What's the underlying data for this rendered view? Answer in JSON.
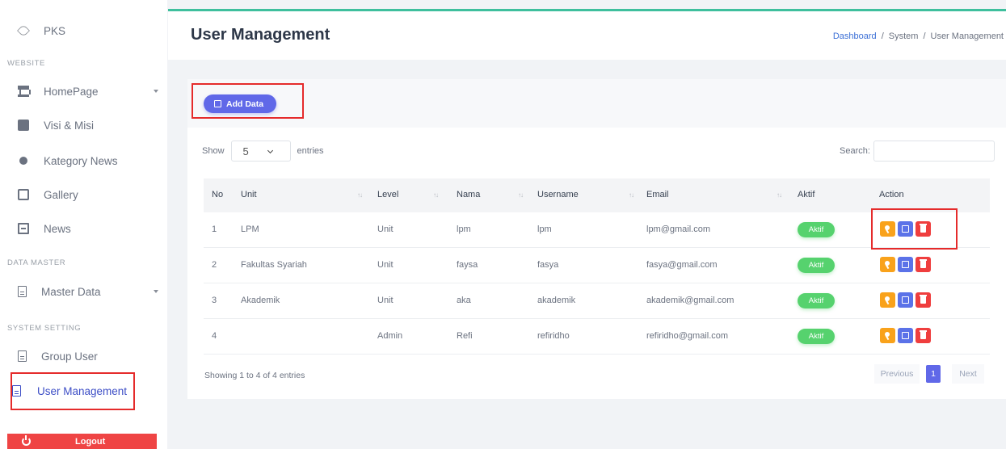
{
  "app": {
    "brand": "PKS",
    "page_title": "User Management"
  },
  "breadcrumb": [
    "Dashboard",
    "System",
    "User Management"
  ],
  "breadcrumb_sep": "/",
  "sidebar": {
    "section_website": "WEBSITE",
    "section_data_master": "DATA MASTER",
    "section_system": "SYSTEM SETTING",
    "items": [
      {
        "label": "HomePage",
        "icon": "bank-icon"
      },
      {
        "label": "Visi & Misi",
        "icon": "id-card-icon"
      },
      {
        "label": "Kategory News",
        "icon": "dot-icon"
      },
      {
        "label": "Gallery",
        "icon": "image-icon"
      },
      {
        "label": "News",
        "icon": "newspaper-icon"
      },
      {
        "label": "Master Data",
        "icon": "document-icon"
      },
      {
        "label": "Group User",
        "icon": "document-icon"
      },
      {
        "label": "User Management",
        "icon": "document-icon",
        "active": true
      }
    ],
    "logout_label": "Logout"
  },
  "toolbar": {
    "add_label": "Add Data"
  },
  "table_controls": {
    "show_label": "Show",
    "entries_value": "5",
    "entries_label": "entries",
    "search_label": "Search:",
    "search_value": ""
  },
  "table": {
    "columns": [
      "No",
      "Unit",
      "Level",
      "Nama",
      "Username",
      "Email",
      "Aktif",
      "Action"
    ],
    "rows": [
      {
        "no": "1",
        "unit": "LPM",
        "level": "Unit",
        "nama": "lpm",
        "username": "lpm",
        "email": "lpm@gmail.com",
        "aktif": "Aktif"
      },
      {
        "no": "2",
        "unit": "Fakultas Syariah",
        "level": "Unit",
        "nama": "faysa",
        "username": "fasya",
        "email": "fasya@gmail.com",
        "aktif": "Aktif"
      },
      {
        "no": "3",
        "unit": "Akademik",
        "level": "Unit",
        "nama": "aka",
        "username": "akademik",
        "email": "akademik@gmail.com",
        "aktif": "Aktif"
      },
      {
        "no": "4",
        "unit": "",
        "level": "Admin",
        "nama": "Refi",
        "username": "refiridho",
        "email": "refiridho@gmail.com",
        "aktif": "Aktif"
      }
    ]
  },
  "footer": {
    "info": "Showing 1 to 4 of 4 entries",
    "prev_label": "Previous",
    "page": "1",
    "next_label": "Next"
  },
  "colors": {
    "accent": "#6068e8",
    "topbar": "#3ebf9d",
    "badge_active": "#56d26e",
    "key_button": "#f9a21b",
    "edit_button": "#5b72e8",
    "delete_button": "#ef3e3e",
    "highlight_box": "#e52b2b"
  }
}
